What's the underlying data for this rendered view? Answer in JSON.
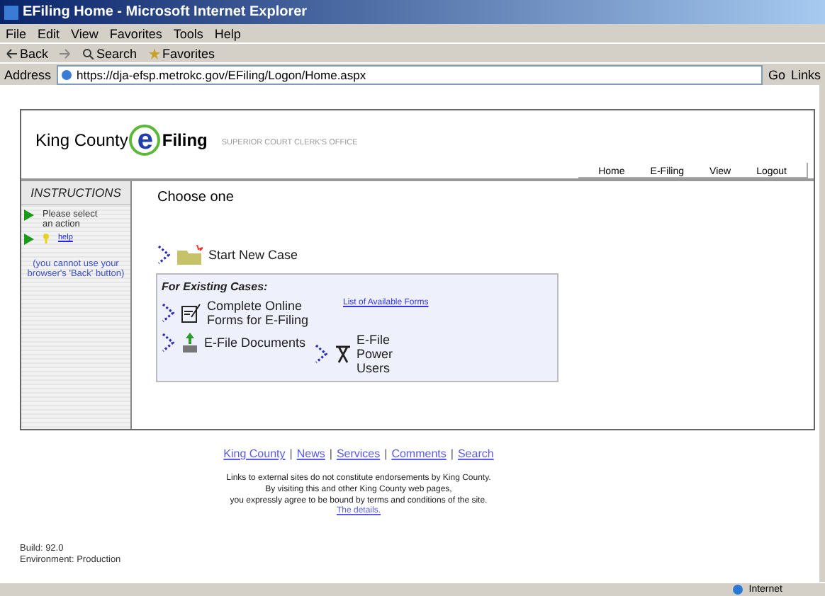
{
  "window": {
    "title": "EFiling Home - Microsoft Internet Explorer"
  },
  "menu": [
    "File",
    "Edit",
    "View",
    "Favorites",
    "Tools",
    "Help"
  ],
  "toolbar": [
    {
      "kind": "back",
      "label": "Back"
    },
    {
      "kind": "forward"
    },
    {
      "kind": "search",
      "label": "Search"
    },
    {
      "kind": "favorites",
      "label": "Favorites"
    }
  ],
  "address": {
    "label": "Address",
    "value": "https://dja-efsp.metrokc.gov/EFiling/Logon/Home.aspx",
    "go": "Go",
    "links": "Links"
  },
  "header": {
    "brand_left": "King County",
    "brand_letter": "e",
    "brand_right": "Filing",
    "subtitle": "SUPERIOR COURT CLERK'S OFFICE",
    "nav": [
      "Home",
      "E-Filing",
      "View",
      "Logout"
    ]
  },
  "instructions": {
    "title": "INSTRUCTIONS",
    "steps": [
      "Please select an action",
      "help"
    ],
    "note": "(you cannot use your browser's 'Back' button)"
  },
  "main": {
    "heading": "Choose one",
    "start": "Start New Case",
    "existing_title": "For Existing Cases:",
    "forms": "Complete Online Forms for E-Filing",
    "forms_link": "List of Available Forms",
    "documents": "E-File Documents",
    "power": "E-File Power Users"
  },
  "footer": {
    "separator": "|",
    "links": [
      "King County",
      "News",
      "Services",
      "Comments",
      "Search"
    ],
    "disclaimer": [
      "Links to external sites do not constitute endorsements by King County.",
      "By visiting this and other King County web pages,",
      "you expressly agree to be bound by terms and conditions of the site."
    ],
    "details": "The details."
  },
  "build": [
    "Build: 92.0",
    "Environment: Production"
  ],
  "status_bar": {
    "zone": "Internet"
  }
}
